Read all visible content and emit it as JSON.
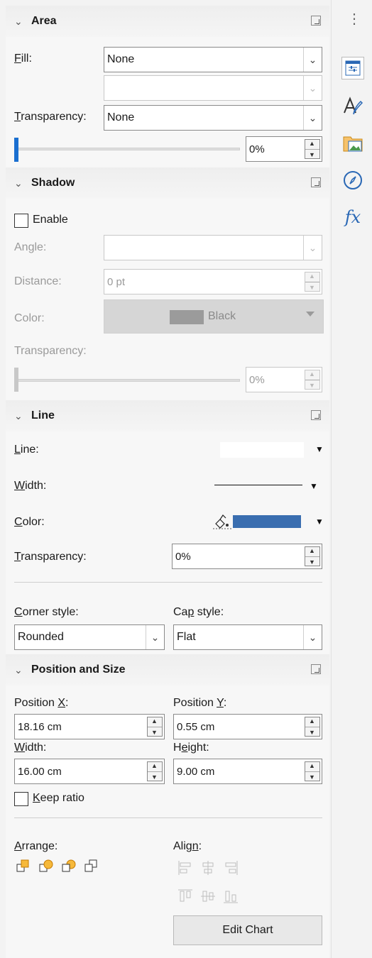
{
  "tabbar": {
    "menu_glyph": "⋮",
    "icons": [
      "properties-icon",
      "styles-icon",
      "gallery-icon",
      "navigator-icon",
      "functions-icon"
    ],
    "functions_glyph": "fx"
  },
  "area": {
    "title": "Area",
    "fill_label": "Fill:",
    "fill_value": "None",
    "fill_sub_value": "",
    "transparency_label": "Transparency:",
    "transparency_value": "None",
    "transparency_percent": "0%",
    "transparency_level": 0
  },
  "shadow": {
    "title": "Shadow",
    "enable_label": "Enable",
    "enable_checked": false,
    "angle_label": "Angle:",
    "angle_value": "",
    "distance_label": "Distance:",
    "distance_value": "0 pt",
    "color_label": "Color:",
    "color_value": "Black",
    "color_swatch": "#9b9b9b",
    "transparency_label": "Transparency:",
    "transparency_percent": "0%",
    "transparency_level": 0
  },
  "line": {
    "title": "Line",
    "line_label": "Line:",
    "width_label": "Width:",
    "color_label": "Color:",
    "color_swatch": "#3a6eb0",
    "transparency_label": "Transparency:",
    "transparency_value": "0%",
    "corner_style_label": "Corner style:",
    "corner_style_value": "Rounded",
    "cap_style_label": "Cap style:",
    "cap_style_value": "Flat"
  },
  "position_size": {
    "title": "Position and Size",
    "pos_x_label": "Position X:",
    "pos_x_value": "18.16 cm",
    "pos_y_label": "Position Y:",
    "pos_y_value": "0.55 cm",
    "width_label": "Width:",
    "width_value": "16.00 cm",
    "height_label": "Height:",
    "height_value": "9.00 cm",
    "keep_ratio_label": "Keep ratio",
    "keep_ratio_checked": false,
    "arrange_label": "Arrange:",
    "align_label": "Align:",
    "edit_chart_label": "Edit Chart"
  }
}
